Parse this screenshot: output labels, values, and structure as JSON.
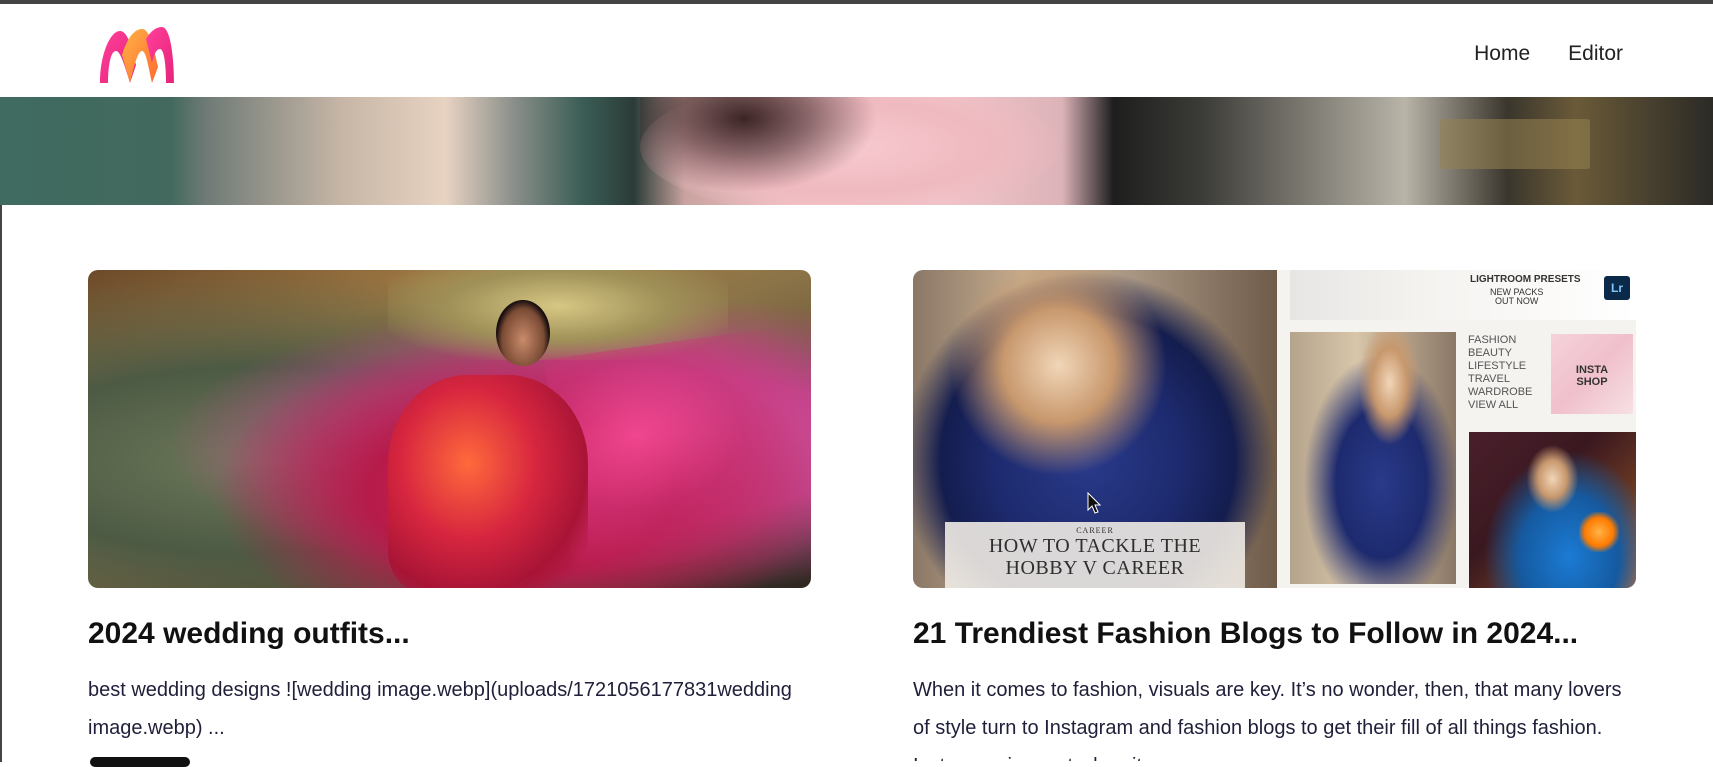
{
  "nav": {
    "home_label": "Home",
    "editor_label": "Editor"
  },
  "brand": {
    "logo_name": "myntra-logo",
    "colors": {
      "pink": "#e6247a",
      "orange": "#ff7a2f"
    }
  },
  "posts": [
    {
      "title": "2024 wedding outfits...",
      "excerpt": "best wedding designs ![wedding image.webp](uploads/172105617783​1wedding image.webp) ..."
    },
    {
      "title": "21 Trendiest Fashion Blogs to Follow in 2024...",
      "excerpt": "When it comes to fashion, visuals are key. It’s no wonder, then, that many lovers of style turn to Instagram and fashion blogs to get their fill of all things fashion. Instagram is great when it com..."
    }
  ],
  "collage": {
    "caption_kicker": "CAREER",
    "caption_headline_line1": "HOW TO TACKLE THE",
    "caption_headline_line2": "HOBBY V CAREER",
    "presets_line1": "LIGHTROOM PRESETS",
    "presets_line2": "NEW PACKS",
    "presets_line3": "OUT NOW",
    "lr_badge": "Lr",
    "menu": [
      "FASHION",
      "BEAUTY",
      "LIFESTYLE",
      "TRAVEL",
      "WARDROBE",
      "VIEW ALL"
    ],
    "insta_line1": "INSTA",
    "insta_line2": "SHOP"
  }
}
